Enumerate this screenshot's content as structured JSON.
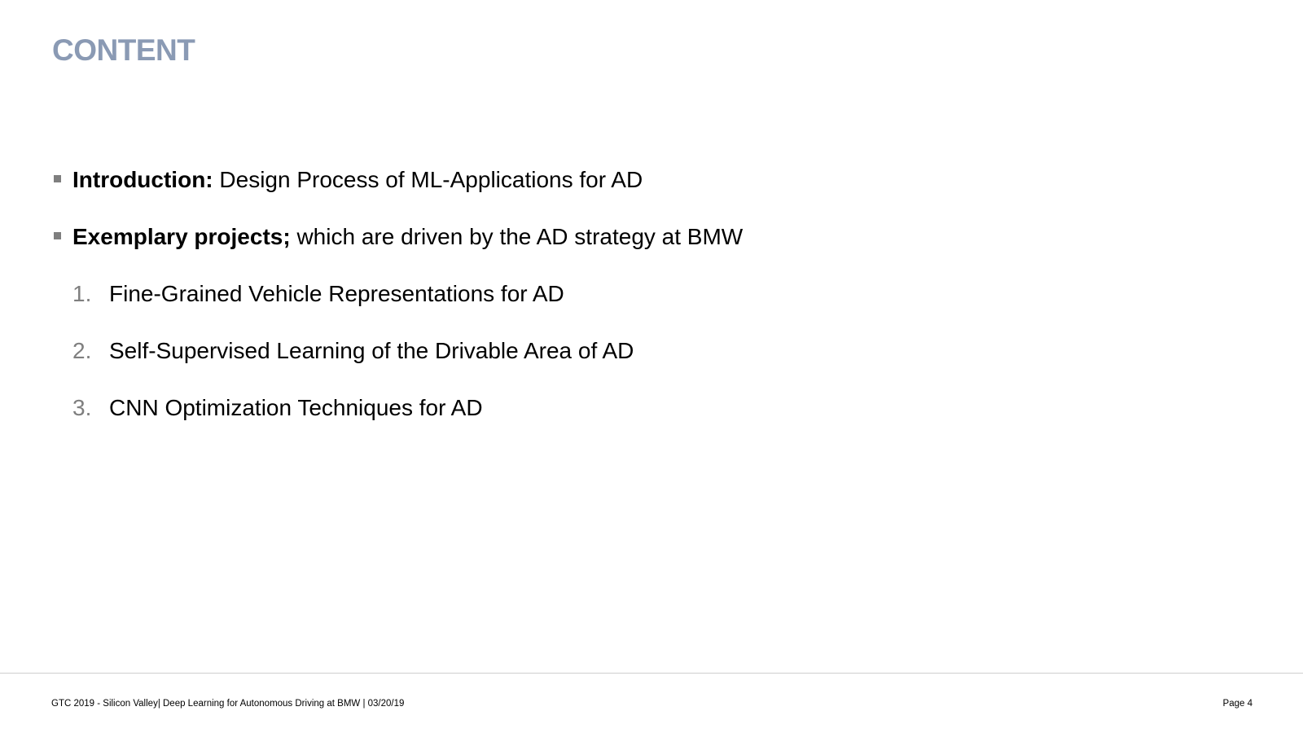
{
  "slide": {
    "title": "CONTENT",
    "bullets": [
      {
        "label": "Introduction:",
        "text": " Design Process of ML-Applications for AD"
      },
      {
        "label": "Exemplary projects;",
        "text": " which are driven by the AD strategy at BMW"
      }
    ],
    "numbered": [
      {
        "num": "1.",
        "text": "Fine-Grained Vehicle Representations for AD"
      },
      {
        "num": "2.",
        "text": "Self-Supervised Learning of the Drivable Area of AD"
      },
      {
        "num": "3.",
        "text": "CNN Optimization Techniques for AD"
      }
    ]
  },
  "footer": {
    "left": "GTC 2019 - Silicon Valley| Deep Learning for Autonomous Driving at BMW | 03/20/19",
    "page": "Page 4"
  },
  "colors": {
    "title": "#8a9ab4",
    "bullet_marker": "#7f7f7f",
    "number": "#7f7f7f",
    "footer_rule": "#cfcfcf"
  }
}
